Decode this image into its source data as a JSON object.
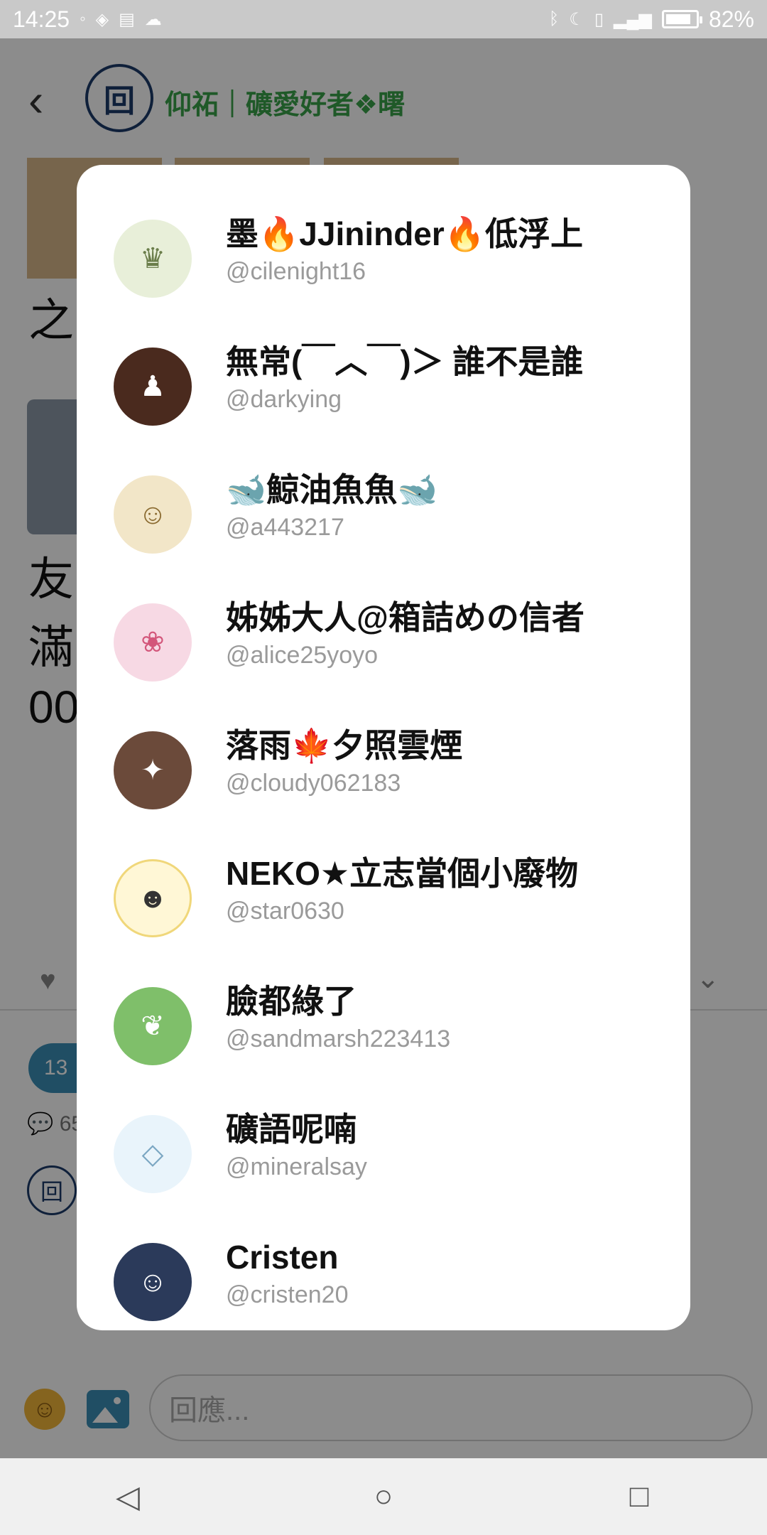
{
  "status_bar": {
    "time": "14:25",
    "battery": "82%",
    "battery_level": 0.82,
    "left_icons": [
      "notification-icon",
      "game-icon",
      "storage-icon",
      "cloud-icon"
    ],
    "right_icons": [
      "bluetooth-icon",
      "moon-icon",
      "vibrate-icon",
      "signal-4g-icon",
      "battery-icon"
    ]
  },
  "post": {
    "author_name": "仰祏｜礦愛好者❖曙",
    "background_chars": [
      "之",
      "友",
      "滿",
      "00"
    ],
    "like_count_partial": "13",
    "comment_count_partial": "65"
  },
  "reply": {
    "placeholder": "回應..."
  },
  "likers": [
    {
      "name": "墨🔥JJininder🔥低浮上",
      "handle": "@cilenight16",
      "avatar_color": "#e8efd9"
    },
    {
      "name": "無常(￣︿￣)＞ 誰不是誰",
      "handle": "@darkying",
      "avatar_color": "#4a2a1e"
    },
    {
      "name": "🐋鯨油魚魚🐋",
      "handle": "@a443217",
      "avatar_color": "#f2e6c8"
    },
    {
      "name": "姊姊大人@箱詰めの信者",
      "handle": "@alice25yoyo",
      "avatar_color": "#f7d9e4"
    },
    {
      "name": "落雨🍁夕照雲煙",
      "handle": "@cloudy062183",
      "avatar_color": "#6b4a3a"
    },
    {
      "name": "NEKO★立志當個小廢物",
      "handle": "@star0630",
      "avatar_color": "#fff7d6"
    },
    {
      "name": "臉都綠了",
      "handle": "@sandmarsh223413",
      "avatar_color": "#7fbf6a"
    },
    {
      "name": "礦語呢喃",
      "handle": "@mineralsay",
      "avatar_color": "#e9f4fb"
    },
    {
      "name": "Cristen",
      "handle": "@cristen20",
      "avatar_color": "#2b3a5a"
    }
  ],
  "navigation": {
    "back_label": "◁",
    "home_label": "○",
    "recent_label": "□"
  }
}
